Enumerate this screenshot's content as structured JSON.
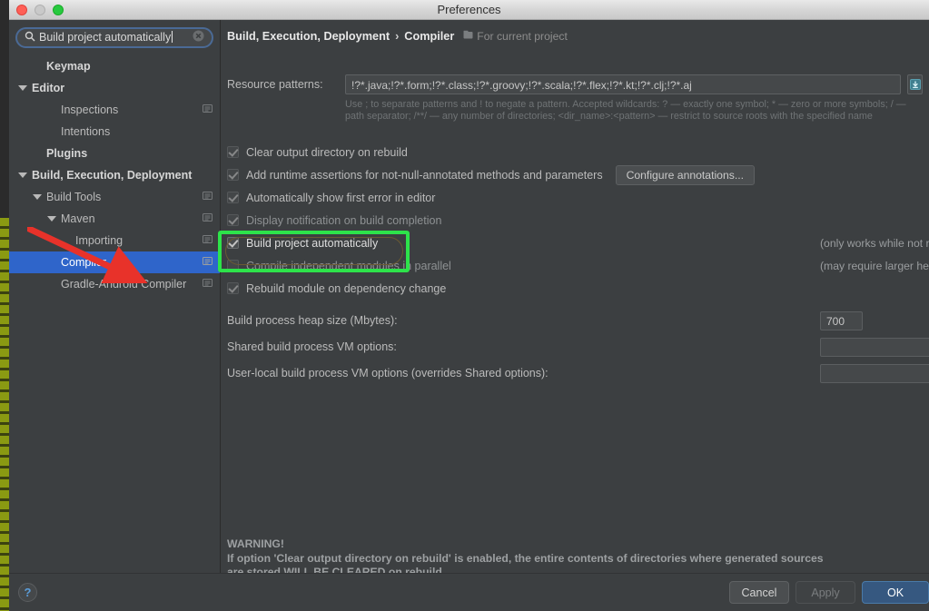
{
  "window": {
    "title": "Preferences",
    "traffic_lights": [
      "close-button",
      "minimize-button",
      "zoom-button"
    ]
  },
  "sidebar": {
    "search": {
      "value": "Build project automatically",
      "placeholder": "Search",
      "icon": "search-icon",
      "clear_icon": "clear-icon"
    },
    "items": [
      {
        "label": "Keymap",
        "indent": 1,
        "expander": "none",
        "bold": true,
        "selected": false,
        "scope_icon": false
      },
      {
        "label": "Editor",
        "indent": 0,
        "expander": "expanded",
        "bold": true,
        "selected": false,
        "scope_icon": false
      },
      {
        "label": "Inspections",
        "indent": 2,
        "expander": "none",
        "bold": false,
        "selected": false,
        "scope_icon": true
      },
      {
        "label": "Intentions",
        "indent": 2,
        "expander": "none",
        "bold": false,
        "selected": false,
        "scope_icon": false
      },
      {
        "label": "Plugins",
        "indent": 1,
        "expander": "none",
        "bold": true,
        "selected": false,
        "scope_icon": false
      },
      {
        "label": "Build, Execution, Deployment",
        "indent": 0,
        "expander": "expanded",
        "bold": true,
        "selected": false,
        "scope_icon": false
      },
      {
        "label": "Build Tools",
        "indent": 1,
        "expander": "expanded",
        "bold": false,
        "selected": false,
        "scope_icon": true
      },
      {
        "label": "Maven",
        "indent": 2,
        "expander": "expanded",
        "bold": false,
        "selected": false,
        "scope_icon": true
      },
      {
        "label": "Importing",
        "indent": 3,
        "expander": "none",
        "bold": false,
        "selected": false,
        "scope_icon": true
      },
      {
        "label": "Compiler",
        "indent": 2,
        "expander": "none",
        "bold": false,
        "selected": true,
        "scope_icon": true
      },
      {
        "label": "Gradle-Android Compiler",
        "indent": 2,
        "expander": "none",
        "bold": false,
        "selected": false,
        "scope_icon": true
      }
    ]
  },
  "main": {
    "breadcrumb": {
      "root": "Build, Execution, Deployment",
      "separator": "›",
      "leaf": "Compiler",
      "scope_note": "For current project",
      "scope_icon": "project-scope-icon"
    },
    "resource_patterns": {
      "label": "Resource patterns:",
      "value": "!?*.java;!?*.form;!?*.class;!?*.groovy;!?*.scala;!?*.flex;!?*.kt;!?*.clj;!?*.aj",
      "expand_icon": "expand-editor-icon",
      "hint": "Use ; to separate patterns and ! to negate a pattern. Accepted wildcards: ? — exactly one symbol; * — zero or more symbols; / — path separator; /**/ — any number of directories; <dir_name>:<pattern> — restrict to source roots with the specified name"
    },
    "checkboxes": [
      {
        "label": "Clear output directory on rebuild",
        "checked": true,
        "enabled": false,
        "emphasis": "normal",
        "hint": ""
      },
      {
        "label": "Add runtime assertions for not-null-annotated methods and parameters",
        "checked": true,
        "enabled": false,
        "emphasis": "normal",
        "hint": "",
        "button": "Configure annotations..."
      },
      {
        "label": "Automatically show first error in editor",
        "checked": true,
        "enabled": false,
        "emphasis": "normal",
        "hint": ""
      },
      {
        "label": "Display notification on build completion",
        "checked": true,
        "enabled": false,
        "emphasis": "dim",
        "hint": ""
      },
      {
        "label": "Build project automatically",
        "checked": true,
        "enabled": true,
        "emphasis": "strong",
        "hint": "(only works while not running / debugging)",
        "highlighted": true
      },
      {
        "label": "Compile independent modules in parallel",
        "checked": false,
        "enabled": false,
        "emphasis": "dim",
        "hint": "(may require larger heap size)"
      },
      {
        "label": "Rebuild module on dependency change",
        "checked": true,
        "enabled": false,
        "emphasis": "normal",
        "hint": ""
      }
    ],
    "fields": [
      {
        "label": "Build process heap size (Mbytes):",
        "value": "700",
        "size": "small"
      },
      {
        "label": "Shared build process VM options:",
        "value": "",
        "size": "wide"
      },
      {
        "label": "User-local build process VM options (overrides Shared options):",
        "value": "",
        "size": "wide"
      }
    ],
    "warning": {
      "line1": "WARNING!",
      "line2": "If option 'Clear output directory on rebuild' is enabled, the entire contents of directories where generated sources",
      "line3": "are stored WILL BE CLEARED on rebuild."
    }
  },
  "footer": {
    "help_label": "?",
    "cancel_label": "Cancel",
    "apply_label": "Apply",
    "ok_label": "OK"
  },
  "annotations": {
    "highlight_color": "#2de34a",
    "arrow_color": "#e8322a",
    "selection_color": "#2f65ca"
  }
}
